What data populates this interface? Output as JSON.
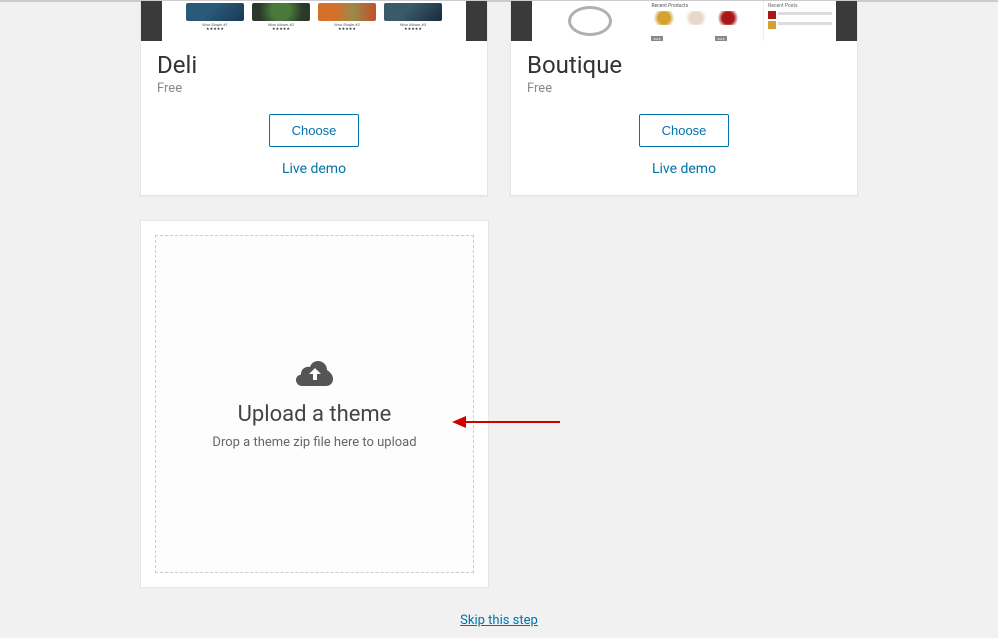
{
  "themes": [
    {
      "name": "Deli",
      "price": "Free",
      "choose_label": "Choose",
      "demo_label": "Live demo",
      "thumb_labels": [
        "Woo Single #1",
        "Woo Album #2",
        "Woo Single #2",
        "Woo Album #3"
      ]
    },
    {
      "name": "Boutique",
      "price": "Free",
      "choose_label": "Choose",
      "demo_label": "Live demo",
      "section_title": "Recent Products",
      "sidebar_title": "Recent Posts"
    }
  ],
  "upload": {
    "title": "Upload a theme",
    "description": "Drop a theme zip file here to upload"
  },
  "footer": {
    "skip_label": "Skip this step"
  }
}
